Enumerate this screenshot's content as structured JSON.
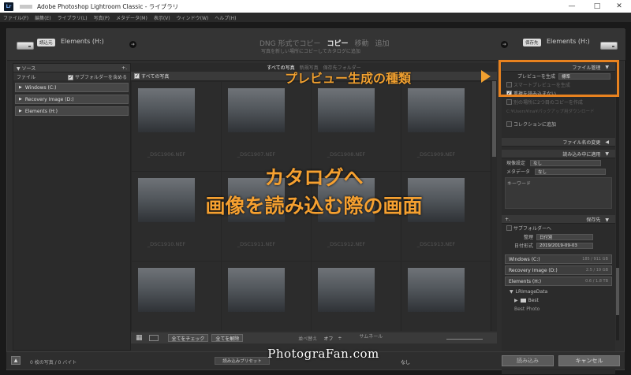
{
  "window": {
    "title": "Adobe Photoshop Lightroom Classic - ライブラリ",
    "app_icon": "Lr",
    "controls": [
      "—",
      "□",
      "✕"
    ]
  },
  "menu": [
    "ファイル(F)",
    "編集(E)",
    "ライブラリ(L)",
    "写真(P)",
    "メタデータ(M)",
    "表示(V)",
    "ウィンドウ(W)",
    "ヘルプ(H)"
  ],
  "import": {
    "source_badge": "読込元",
    "source_drive": "Elements (H:)",
    "dest_badge": "保存先",
    "dest_drive": "Elements (H:)",
    "modes": [
      "DNG 形式でコピー",
      "コピー",
      "移動",
      "追加"
    ],
    "active_mode": "コピー",
    "mode_desc": "写真を新しい場所にコピーしてカタログに追加"
  },
  "source_panel": {
    "title": "ソース",
    "files_label": "ファイル",
    "include_subfolders": "サブフォルダーを含める",
    "volumes": [
      "Windows (C:)",
      "Recovery Image (D:)",
      "Elements (H:)"
    ]
  },
  "center": {
    "tabs": [
      "すべての写真",
      "新規写真",
      "保存先フォルダー"
    ],
    "all_photos": "すべての写真",
    "thumbnails": [
      "_DSC1906.NEF",
      "_DSC1907.NEF",
      "_DSC1908.NEF",
      "_DSC1909.NEF",
      "_DSC1910.NEF",
      "_DSC1911.NEF",
      "_DSC1912.NEF",
      "_DSC1913.NEF",
      "",
      "",
      "",
      ""
    ],
    "toolbar": {
      "check_all": "全てをチェック",
      "uncheck_all": "全てを解除",
      "sort_label": "並べ替え",
      "sort_value": "オフ",
      "thumb_label": "サムネール"
    }
  },
  "right_panel": {
    "file_handling": "ファイル管理",
    "preview_label": "プレビューを生成",
    "preview_value": "標準",
    "smart_preview": "スマートプレビューを生成",
    "dont_import_dupes": "重複を読み込まない",
    "second_copy": "別の場所に2つ目のコピーを作成",
    "second_copy_path": "C:¥Users¥ina¥パックアップ用ダウンロード",
    "add_collection": "コレクションに追加",
    "rename": "ファイル名の変更",
    "apply_during": "読み込み中に適用",
    "develop_label": "現像設定",
    "develop_value": "なし",
    "metadata_label": "メタデータ",
    "metadata_value": "なし",
    "keyword_label": "キーワード",
    "destination": "保存先",
    "into_subfolder": "サブフォルダーへ",
    "organize_label": "整理",
    "organize_value": "日付別",
    "date_label": "日付形式",
    "date_value": "2019/2019-09-03",
    "volumes": [
      {
        "name": "Windows (C:)",
        "size": "185 / 911 GB"
      },
      {
        "name": "Recovery Image (D:)",
        "size": "2.5 / 19 GB"
      },
      {
        "name": "Elements (H:)",
        "size": "0.6 / 1.8 TB"
      }
    ],
    "folder_1": "LRImageData",
    "folder_2": "Best",
    "folder_3": "Best Photo"
  },
  "status": {
    "left": "0 枚の写真 / 0 バイト",
    "preset_label": "読み込みプリセット",
    "preset_value": "なし",
    "import_button": "読み込み",
    "cancel_button": "キャンセル"
  },
  "overlay": {
    "preview_label": "プレビュー生成の種類",
    "center_line1": "カタログへ",
    "center_line2": "画像を読み込む際の画面",
    "watermark": "PhotograFan.com",
    "accent": "#e8821f"
  }
}
